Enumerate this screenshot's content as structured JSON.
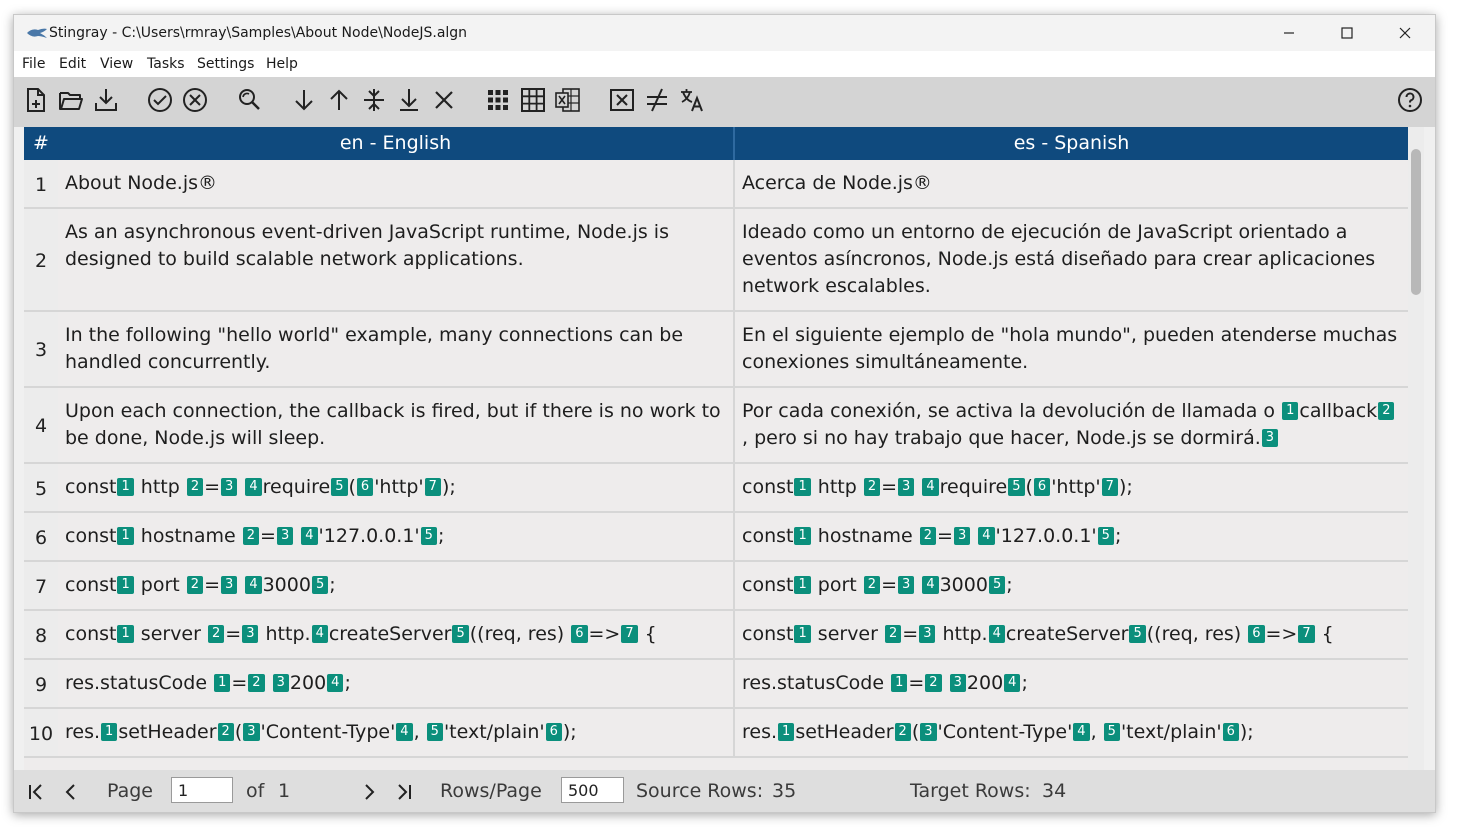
{
  "window": {
    "title": "Stingray - C:\\Users\\rmray\\Samples\\About Node\\NodeJS.algn"
  },
  "menu": [
    "File",
    "Edit",
    "View",
    "Tasks",
    "Settings",
    "Help"
  ],
  "toolbar_icons": [
    "new-file-icon",
    "open-folder-icon",
    "save-download-icon",
    "check-circle-icon",
    "cancel-circle-icon",
    "find-replace-icon",
    "arrow-down-icon",
    "arrow-up-icon",
    "split-icon",
    "move-bottom-icon",
    "delete-x-icon",
    "grid-dots-icon",
    "table-icon",
    "excel-icon",
    "close-box-icon",
    "not-equal-icon",
    "translate-icon",
    "help-icon"
  ],
  "grid": {
    "headers": {
      "num": "#",
      "source": "en - English",
      "target": "es - Spanish"
    },
    "rows": [
      {
        "num": "1",
        "height": 49,
        "en": [
          {
            "t": "About Node.js®"
          }
        ],
        "es": [
          {
            "t": "Acerca de Node.js®"
          }
        ]
      },
      {
        "num": "2",
        "height": 103,
        "en": [
          {
            "t": "As an asynchronous event-driven JavaScript runtime, Node.js is designed to build scalable network applications."
          }
        ],
        "es": [
          {
            "t": "Ideado como un entorno de ejecución de JavaScript orientado a eventos asíncronos, Node.js está diseñado para crear aplicaciones network escalables."
          }
        ]
      },
      {
        "num": "3",
        "height": 76,
        "en": [
          {
            "t": "In the following \"hello world\" example, many connections can be handled concurrently."
          }
        ],
        "es": [
          {
            "t": "En el siguiente ejemplo de \"hola mundo\", pueden atenderse muchas conexiones simultáneamente."
          }
        ]
      },
      {
        "num": "4",
        "height": 76,
        "en": [
          {
            "t": "Upon each connection, the callback is fired, but if there is no work to be done, Node.js will sleep."
          }
        ],
        "es": [
          {
            "t": "Por cada conexión, se activa la devolución de llamada o "
          },
          {
            "g": "1"
          },
          {
            "t": "callback"
          },
          {
            "g": "2"
          },
          {
            "t": ", pero si no hay trabajo que hacer, Node.js se dormirá."
          },
          {
            "g": "3"
          }
        ]
      },
      {
        "num": "5",
        "height": 49,
        "en": [
          {
            "t": "const"
          },
          {
            "g": "1"
          },
          {
            "t": " http "
          },
          {
            "g": "2"
          },
          {
            "t": "="
          },
          {
            "g": "3"
          },
          {
            "t": " "
          },
          {
            "g": "4"
          },
          {
            "t": "require"
          },
          {
            "g": "5"
          },
          {
            "t": "("
          },
          {
            "g": "6"
          },
          {
            "t": "'http'"
          },
          {
            "g": "7"
          },
          {
            "t": ");"
          }
        ],
        "es": [
          {
            "t": "const"
          },
          {
            "g": "1"
          },
          {
            "t": " http "
          },
          {
            "g": "2"
          },
          {
            "t": "="
          },
          {
            "g": "3"
          },
          {
            "t": " "
          },
          {
            "g": "4"
          },
          {
            "t": "require"
          },
          {
            "g": "5"
          },
          {
            "t": "("
          },
          {
            "g": "6"
          },
          {
            "t": "'http'"
          },
          {
            "g": "7"
          },
          {
            "t": ");"
          }
        ]
      },
      {
        "num": "6",
        "height": 49,
        "en": [
          {
            "t": "const"
          },
          {
            "g": "1"
          },
          {
            "t": " hostname "
          },
          {
            "g": "2"
          },
          {
            "t": "="
          },
          {
            "g": "3"
          },
          {
            "t": " "
          },
          {
            "g": "4"
          },
          {
            "t": "'127.0.0.1'"
          },
          {
            "g": "5"
          },
          {
            "t": ";"
          }
        ],
        "es": [
          {
            "t": "const"
          },
          {
            "g": "1"
          },
          {
            "t": " hostname "
          },
          {
            "g": "2"
          },
          {
            "t": "="
          },
          {
            "g": "3"
          },
          {
            "t": " "
          },
          {
            "g": "4"
          },
          {
            "t": "'127.0.0.1'"
          },
          {
            "g": "5"
          },
          {
            "t": ";"
          }
        ]
      },
      {
        "num": "7",
        "height": 49,
        "en": [
          {
            "t": "const"
          },
          {
            "g": "1"
          },
          {
            "t": " port "
          },
          {
            "g": "2"
          },
          {
            "t": "="
          },
          {
            "g": "3"
          },
          {
            "t": " "
          },
          {
            "g": "4"
          },
          {
            "t": "3000"
          },
          {
            "g": "5"
          },
          {
            "t": ";"
          }
        ],
        "es": [
          {
            "t": "const"
          },
          {
            "g": "1"
          },
          {
            "t": " port "
          },
          {
            "g": "2"
          },
          {
            "t": "="
          },
          {
            "g": "3"
          },
          {
            "t": " "
          },
          {
            "g": "4"
          },
          {
            "t": "3000"
          },
          {
            "g": "5"
          },
          {
            "t": ";"
          }
        ]
      },
      {
        "num": "8",
        "height": 49,
        "en": [
          {
            "t": "const"
          },
          {
            "g": "1"
          },
          {
            "t": " server "
          },
          {
            "g": "2"
          },
          {
            "t": "="
          },
          {
            "g": "3"
          },
          {
            "t": " http."
          },
          {
            "g": "4"
          },
          {
            "t": "createServer"
          },
          {
            "g": "5"
          },
          {
            "t": "((req, res) "
          },
          {
            "g": "6"
          },
          {
            "t": "=>"
          },
          {
            "g": "7"
          },
          {
            "t": " {"
          }
        ],
        "es": [
          {
            "t": "const"
          },
          {
            "g": "1"
          },
          {
            "t": " server "
          },
          {
            "g": "2"
          },
          {
            "t": "="
          },
          {
            "g": "3"
          },
          {
            "t": " http."
          },
          {
            "g": "4"
          },
          {
            "t": "createServer"
          },
          {
            "g": "5"
          },
          {
            "t": "((req, res) "
          },
          {
            "g": "6"
          },
          {
            "t": "=>"
          },
          {
            "g": "7"
          },
          {
            "t": " {"
          }
        ]
      },
      {
        "num": "9",
        "height": 49,
        "en": [
          {
            "t": "res.statusCode "
          },
          {
            "g": "1"
          },
          {
            "t": "="
          },
          {
            "g": "2"
          },
          {
            "t": " "
          },
          {
            "g": "3"
          },
          {
            "t": "200"
          },
          {
            "g": "4"
          },
          {
            "t": ";"
          }
        ],
        "es": [
          {
            "t": "res.statusCode "
          },
          {
            "g": "1"
          },
          {
            "t": "="
          },
          {
            "g": "2"
          },
          {
            "t": " "
          },
          {
            "g": "3"
          },
          {
            "t": "200"
          },
          {
            "g": "4"
          },
          {
            "t": ";"
          }
        ]
      },
      {
        "num": "10",
        "height": 49,
        "en": [
          {
            "t": "res."
          },
          {
            "g": "1"
          },
          {
            "t": "setHeader"
          },
          {
            "g": "2"
          },
          {
            "t": "("
          },
          {
            "g": "3"
          },
          {
            "t": "'Content-Type'"
          },
          {
            "g": "4"
          },
          {
            "t": ", "
          },
          {
            "g": "5"
          },
          {
            "t": "'text/plain'"
          },
          {
            "g": "6"
          },
          {
            "t": ");"
          }
        ],
        "es": [
          {
            "t": "res."
          },
          {
            "g": "1"
          },
          {
            "t": "setHeader"
          },
          {
            "g": "2"
          },
          {
            "t": "("
          },
          {
            "g": "3"
          },
          {
            "t": "'Content-Type'"
          },
          {
            "g": "4"
          },
          {
            "t": ", "
          },
          {
            "g": "5"
          },
          {
            "t": "'text/plain'"
          },
          {
            "g": "6"
          },
          {
            "t": ");"
          }
        ]
      }
    ]
  },
  "status": {
    "page_label": "Page",
    "page_value": "1",
    "of_label": "of",
    "of_value": "1",
    "rows_per_page_label": "Rows/Page",
    "rows_per_page_value": "500",
    "source_rows_label": "Source Rows:",
    "source_rows_value": "35",
    "target_rows_label": "Target Rows:",
    "target_rows_value": "34"
  },
  "colors": {
    "header_bg": "#0f4a7e",
    "tag_bg": "#0b8f7c",
    "toolbar_bg": "#d4d4d4"
  }
}
